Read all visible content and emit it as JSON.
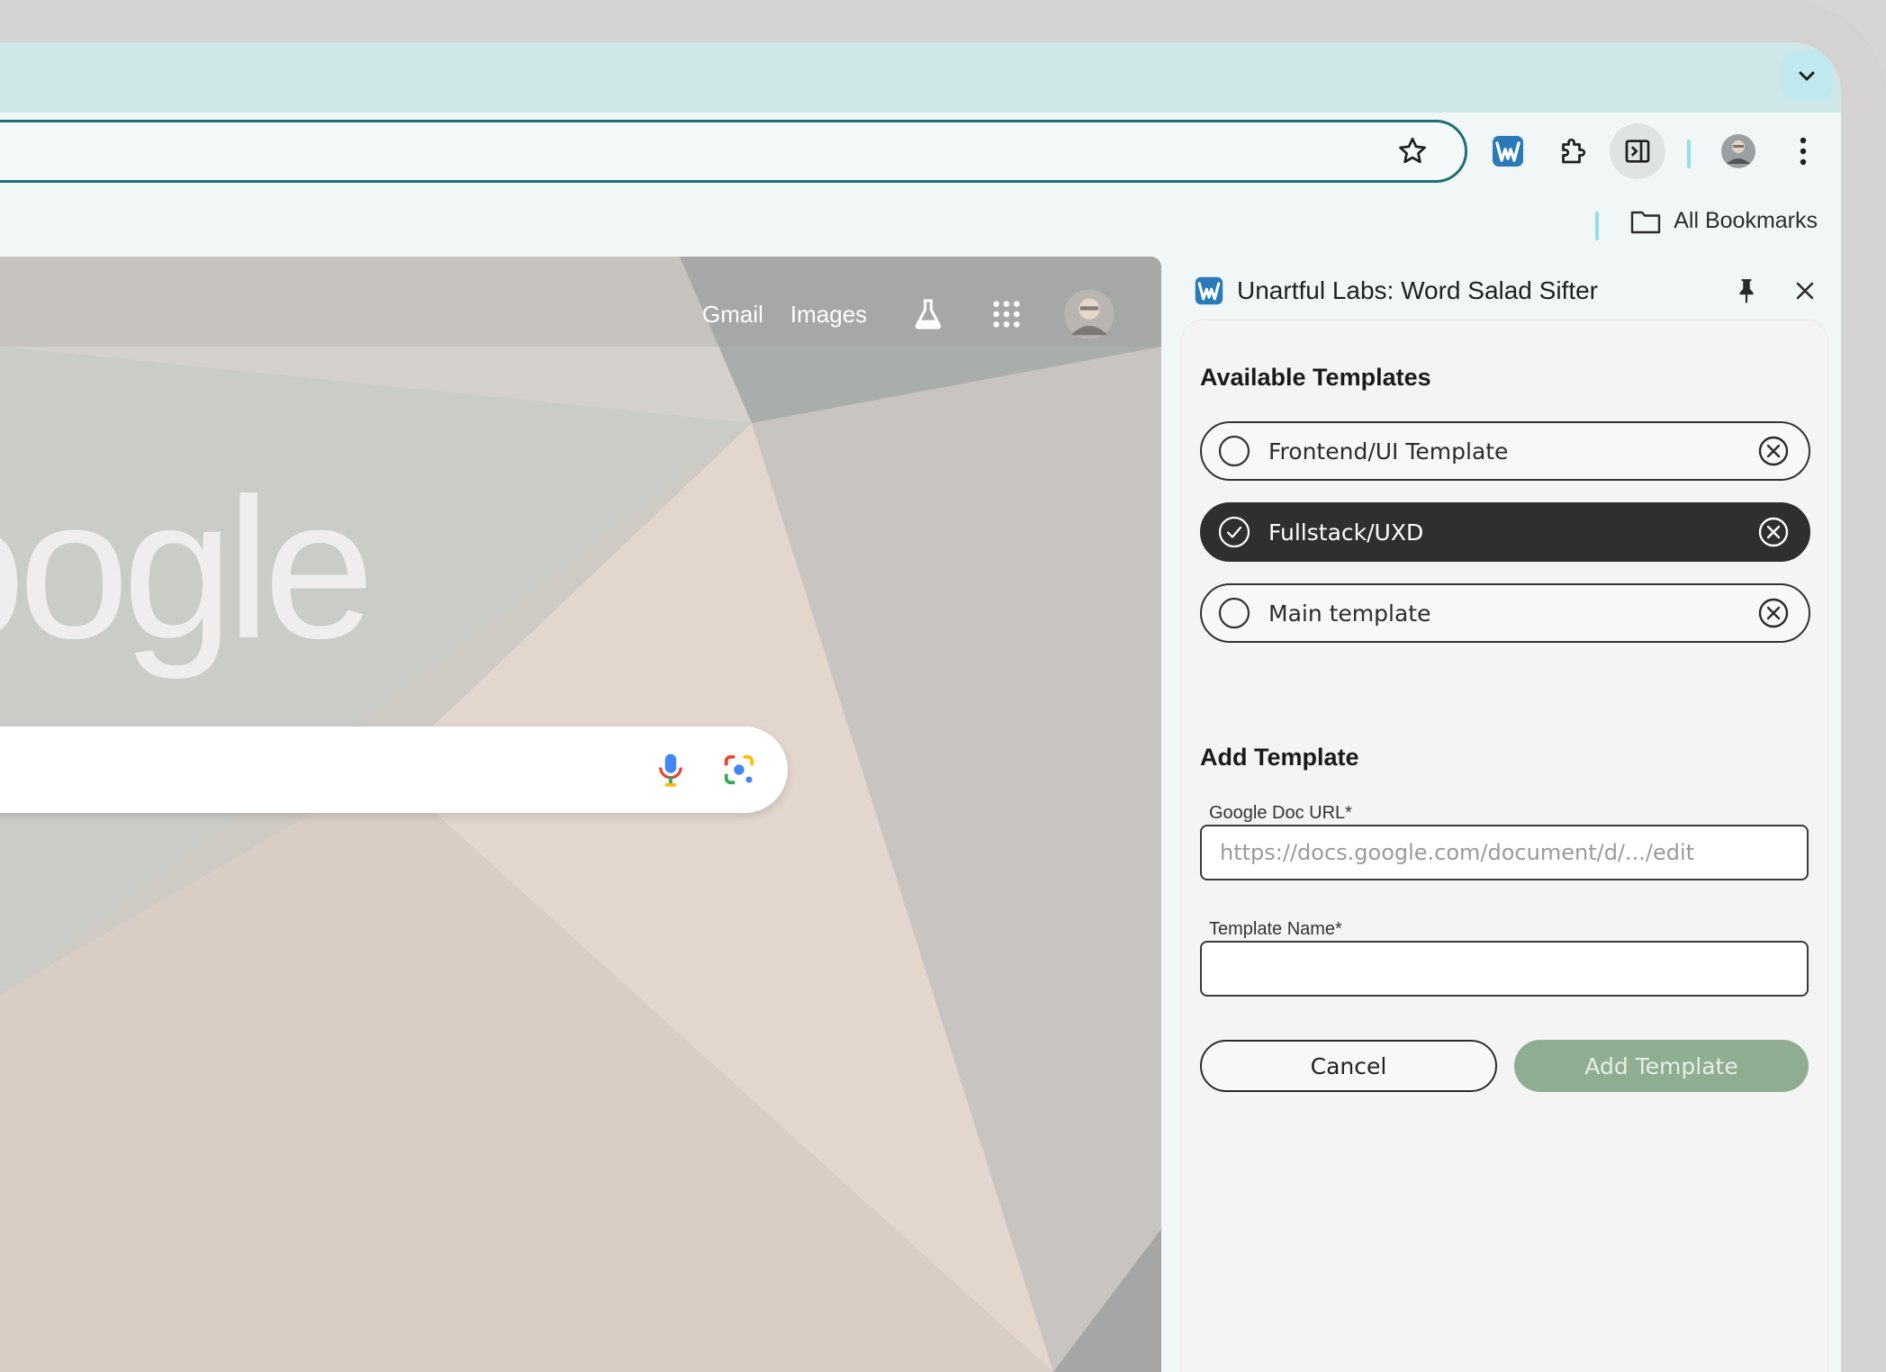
{
  "toolbar": {
    "bookmark_star_icon": "star-icon",
    "extension_icon": "word-salad-extension-icon",
    "extensions_icon": "puzzle-icon",
    "side_panel_icon": "side-panel-icon",
    "profile_icon": "avatar",
    "menu_icon": "kebab-menu-icon"
  },
  "bookmarks_bar": {
    "all_bookmarks_label": "All Bookmarks"
  },
  "google_page": {
    "logo_text": "oogle",
    "links": [
      "Gmail",
      "Images"
    ],
    "voice_icon": "mic-icon",
    "lens_icon": "lens-icon"
  },
  "side_panel": {
    "title": "Unartful Labs: Word Salad Sifter",
    "available_templates_heading": "Available Templates",
    "templates": [
      {
        "label": "Frontend/UI Template",
        "selected": false
      },
      {
        "label": "Fullstack/UXD",
        "selected": true
      },
      {
        "label": "Main template",
        "selected": false
      }
    ],
    "add_template_heading": "Add Template",
    "doc_url_label": "Google Doc URL*",
    "doc_url_placeholder": "https://docs.google.com/document/d/.../edit",
    "doc_url_value": "",
    "template_name_label": "Template Name*",
    "template_name_value": "",
    "cancel_label": "Cancel",
    "add_label": "Add Template"
  },
  "colors": {
    "accent_teal": "#1f6e73",
    "selected_template": "#2f2f2f",
    "add_button": "#8fae91"
  }
}
